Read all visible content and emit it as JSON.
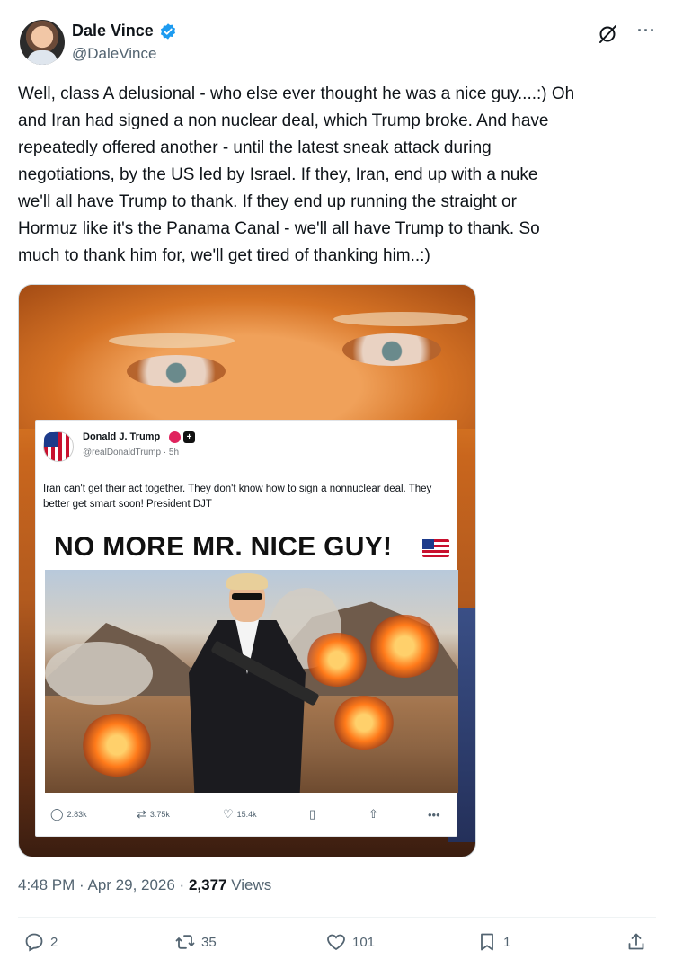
{
  "author": {
    "name": "Dale Vince",
    "handle": "@DaleVince"
  },
  "tweet": {
    "text": "Well, class A delusional - who else ever thought he was a nice guy....:) Oh\nand Iran had signed a non nuclear deal, which Trump broke. And have\nrepeatedly offered another - until the latest sneak attack during\nnegotiations, by the US led by Israel. If they, Iran, end up with a nuke\nwe'll all have Trump to thank. If they end up running the straight or\nHormuz like it's the Panama Canal - we'll all have Trump to thank. So\nmuch to thank him for, we'll get tired of thanking him..:)"
  },
  "embedded_post": {
    "name": "Donald J. Trump",
    "handle": "@realDonaldTrump · 5h",
    "text": "Iran can't get their act together. They don't know how to sign a nonnuclear deal. They better get smart soon! President DJT",
    "headline": "NO MORE MR. NICE GUY!",
    "badge_label": "+",
    "stats": {
      "replies": "2.83k",
      "reposts": "3.75k",
      "likes": "15.4k"
    },
    "more": "•••"
  },
  "meta": {
    "time": "4:48 PM · Apr 29, 2026 · ",
    "views_count": "2,377",
    "views_label": " Views"
  },
  "actions": {
    "replies": "2",
    "reposts": "35",
    "likes": "101",
    "bookmarks": "1"
  },
  "header": {
    "more_label": "···"
  },
  "colors": {
    "verified_blue": "#1d9bf0",
    "muted_text": "#536471",
    "primary_text": "#0f1419"
  }
}
